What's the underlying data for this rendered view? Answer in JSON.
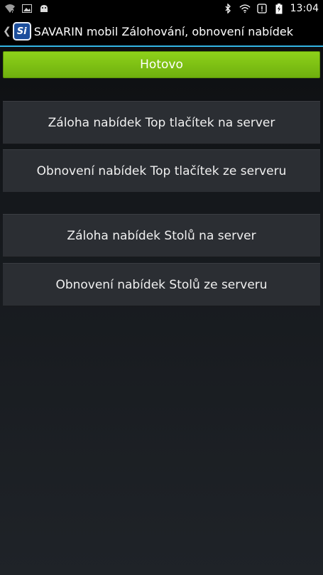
{
  "status_bar": {
    "time": "13:04",
    "left_icons": [
      "wifi-question-icon",
      "image-icon",
      "android-icon"
    ],
    "right_icons": [
      "bluetooth-icon",
      "wifi-icon",
      "alert-icon",
      "battery-charging-icon"
    ]
  },
  "action_bar": {
    "logo_text": "Si",
    "title": "SAVARIN mobil Zálohování, obnovení nabídek",
    "accent_color": "#33b5e5"
  },
  "done_button": {
    "label": "Hotovo",
    "color": "#7cc314"
  },
  "buttons": [
    {
      "label": "Záloha nabídek Top tlačítek na server"
    },
    {
      "label": "Obnovení nabídek Top tlačítek ze serveru"
    },
    {
      "label": "Záloha nabídek Stolů na server"
    },
    {
      "label": "Obnovení nabídek Stolů ze serveru"
    }
  ]
}
